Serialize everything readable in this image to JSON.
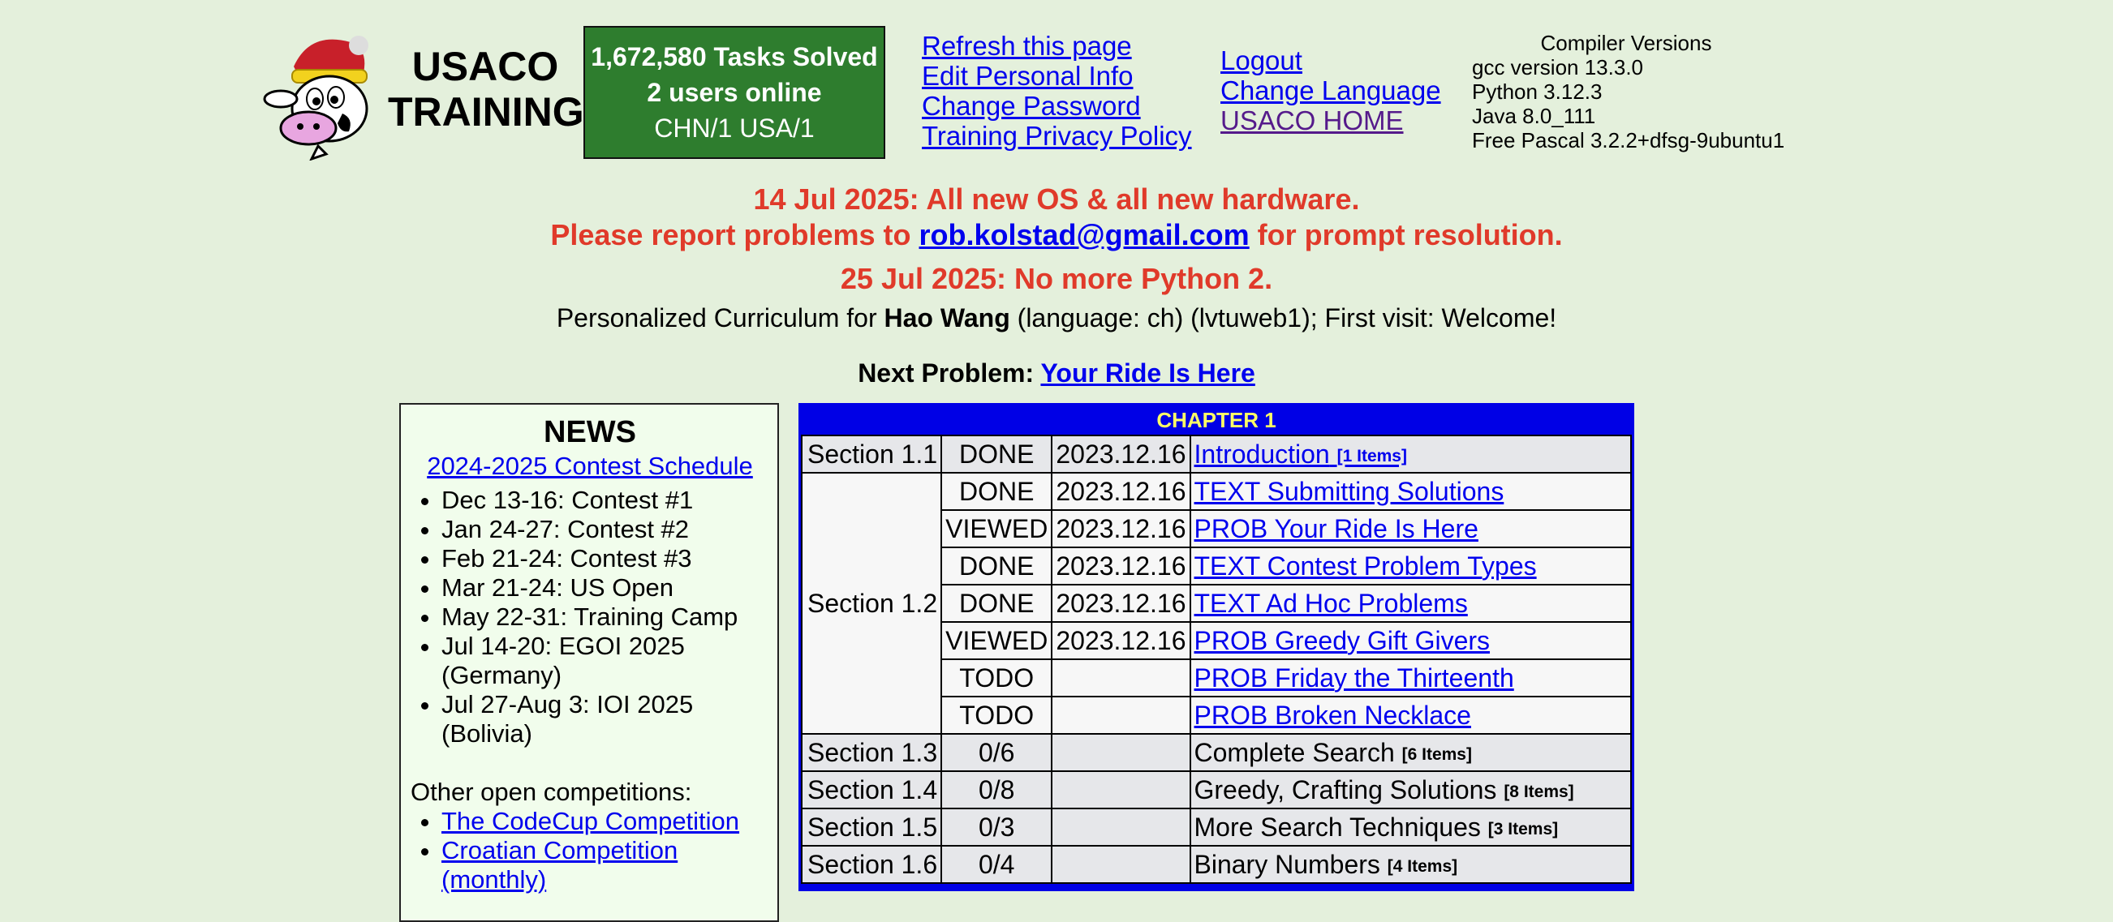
{
  "header": {
    "title_line1": "USACO",
    "title_line2": "TRAINING",
    "stats": {
      "tasks_solved": "1,672,580 Tasks Solved",
      "users_online": "2 users online",
      "countries": "CHN/1 USA/1"
    },
    "links_col1": [
      "Refresh this page",
      "Edit Personal Info",
      "Change Password",
      "Training Privacy Policy"
    ],
    "links_col2": [
      "Logout",
      "Change Language",
      "USACO HOME"
    ],
    "compilers": {
      "heading": "Compiler Versions",
      "items": [
        "gcc version 13.3.0",
        "Python 3.12.3",
        "Java 8.0_111",
        "Free Pascal 3.2.2+dfsg-9ubuntu1"
      ]
    }
  },
  "announcements": {
    "line1": "14 Jul 2025: All new OS & all new hardware.",
    "line2_pre": "Please report problems to ",
    "line2_email": "rob.kolstad@gmail.com",
    "line2_post": " for prompt resolution.",
    "line3": "25 Jul 2025: No more Python 2."
  },
  "curriculum": {
    "pre": "Personalized Curriculum for ",
    "name": "Hao Wang",
    "post": " (language: ch) (lvtuweb1); First visit: Welcome!"
  },
  "next_problem": {
    "label": "Next Problem: ",
    "link": "Your Ride Is Here"
  },
  "news": {
    "heading": "NEWS",
    "schedule_link": "2024-2025 Contest Schedule",
    "items": [
      "Dec 13-16: Contest #1",
      "Jan 24-27: Contest #2",
      "Feb 21-24: Contest #3",
      "Mar 21-24: US Open",
      "May 22-31: Training Camp",
      "Jul 14-20: EGOI 2025 (Germany)",
      "Jul 27-Aug 3: IOI 2025 (Bolivia)"
    ],
    "other_heading": "Other open competitions:",
    "other_links": [
      "The CodeCup Competition",
      "Croatian Competition (monthly)"
    ]
  },
  "chapter": {
    "title": "CHAPTER 1",
    "s11": {
      "section": "Section 1.1",
      "status": "DONE",
      "date": "2023.12.16",
      "link": "Introduction",
      "items": "[1 Items]"
    },
    "s12": {
      "section": "Section 1.2",
      "rows": [
        {
          "status": "DONE",
          "date": "2023.12.16",
          "link": "TEXT Submitting Solutions"
        },
        {
          "status": "VIEWED",
          "date": "2023.12.16",
          "link": "PROB Your Ride Is Here"
        },
        {
          "status": "DONE",
          "date": "2023.12.16",
          "link": "TEXT Contest Problem Types"
        },
        {
          "status": "DONE",
          "date": "2023.12.16",
          "link": "TEXT Ad Hoc Problems"
        },
        {
          "status": "VIEWED",
          "date": "2023.12.16",
          "link": "PROB Greedy Gift Givers"
        },
        {
          "status": "TODO",
          "date": "",
          "link": "PROB Friday the Thirteenth"
        },
        {
          "status": "TODO",
          "date": "",
          "link": "PROB Broken Necklace"
        }
      ]
    },
    "sections": [
      {
        "section": "Section 1.3",
        "status": "0/6",
        "title": "Complete Search",
        "items": "[6 Items]"
      },
      {
        "section": "Section 1.4",
        "status": "0/8",
        "title": "Greedy, Crafting Solutions",
        "items": "[8 Items]"
      },
      {
        "section": "Section 1.5",
        "status": "0/3",
        "title": "More Search Techniques",
        "items": "[3 Items]"
      },
      {
        "section": "Section 1.6",
        "status": "0/4",
        "title": "Binary Numbers",
        "items": "[4 Items]"
      }
    ]
  }
}
